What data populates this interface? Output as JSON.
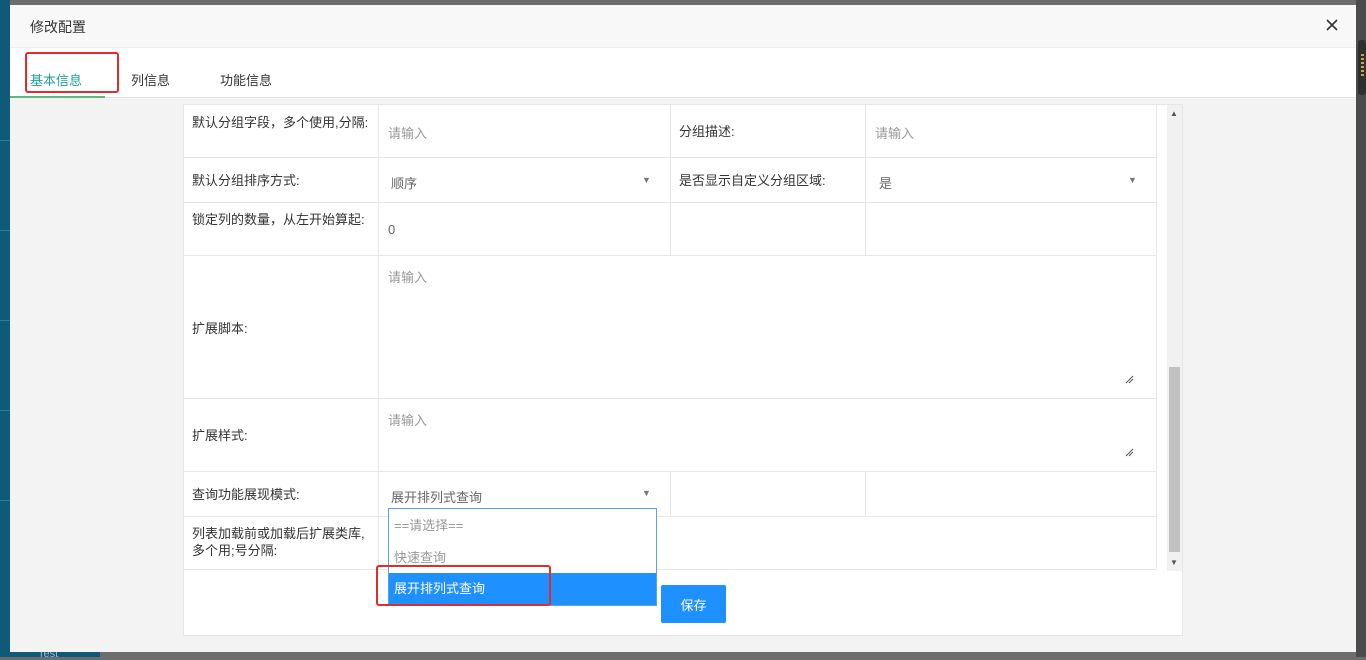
{
  "background": {
    "bottom_text": "Test"
  },
  "dialog": {
    "title": "修改配置",
    "tabs": [
      {
        "label": "基本信息",
        "active": true
      },
      {
        "label": "列信息",
        "active": false
      },
      {
        "label": "功能信息",
        "active": false
      }
    ]
  },
  "form": {
    "row1": {
      "label": "默认分组字段，多个使用,分隔:",
      "placeholder": "请输入",
      "label2": "分组描述:",
      "placeholder2": "请输入"
    },
    "row2": {
      "label": "默认分组排序方式:",
      "value": "顺序",
      "label2": "是否显示自定义分组区域:",
      "value2": "是"
    },
    "row3": {
      "label": "锁定列的数量，从左开始算起:",
      "value": "0"
    },
    "row4": {
      "label": "扩展脚本:",
      "placeholder": "请输入"
    },
    "row5": {
      "label": "扩展样式:",
      "placeholder": "请输入"
    },
    "row6": {
      "label": "查询功能展现模式:",
      "value": "展开排列式查询"
    },
    "row7": {
      "label": "列表加载前或加载后扩展类库,多个用;号分隔:"
    },
    "dropdown_options": [
      "==请选择==",
      "快速查询",
      "展开排列式查询"
    ],
    "dropdown_selected_index": 2,
    "save_label": "保存"
  },
  "colors": {
    "accent": "#1e90ff",
    "tab_active": "#1e9f9a",
    "annotation": "#e12c2c"
  },
  "icons": {
    "close": "close-icon",
    "caret": "chevron-down-icon"
  }
}
